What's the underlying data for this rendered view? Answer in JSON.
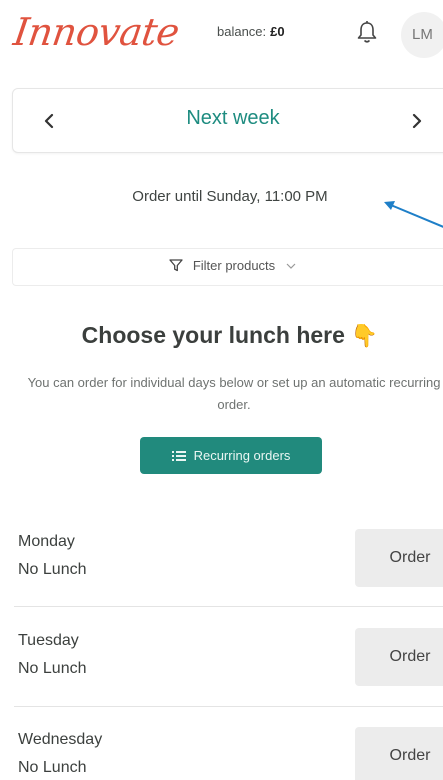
{
  "header": {
    "logo_text": "Innovate",
    "balance_label": "balance:",
    "balance_value": "£0",
    "avatar_initials": "LM"
  },
  "week": {
    "label": "Next week"
  },
  "order_until": "Order until Sunday, 11:00 PM",
  "filter": {
    "label": "Filter products"
  },
  "intro": {
    "title": "Choose your lunch here",
    "title_emoji": "👇",
    "subtitle": "You can order for individual days below or set up an automatic recurring order."
  },
  "recurring_button": {
    "label": "Recurring orders"
  },
  "days": [
    {
      "name": "Monday",
      "status": "No Lunch",
      "button": "Order"
    },
    {
      "name": "Tuesday",
      "status": "No Lunch",
      "button": "Order"
    },
    {
      "name": "Wednesday",
      "status": "No Lunch",
      "button": "Order"
    }
  ],
  "colors": {
    "brand_red": "#e0533f",
    "accent_teal": "#218a7d",
    "annotation_arrow": "#1e7fc8"
  },
  "icons": {
    "notification": "bell-icon",
    "prev": "chevron-left-icon",
    "next": "chevron-right-icon",
    "filter": "funnel-icon",
    "filter_toggle": "chevron-down-icon",
    "recurring": "list-icon",
    "annotation": "arrow-icon"
  }
}
